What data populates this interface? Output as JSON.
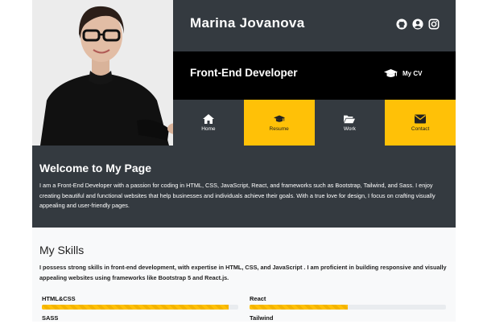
{
  "header": {
    "name": "Marina Jovanova",
    "job_title": "Front-End Developer",
    "cv_label": "My CV",
    "social_icons": [
      "github-icon",
      "user-circle-icon",
      "instagram-icon"
    ]
  },
  "nav": [
    {
      "label": "Home",
      "icon": "home-icon",
      "style": "dark"
    },
    {
      "label": "Resume",
      "icon": "graduation-cap-icon",
      "style": "yellow"
    },
    {
      "label": "Work",
      "icon": "folder-open-icon",
      "style": "dark"
    },
    {
      "label": "Contact",
      "icon": "envelope-icon",
      "style": "yellow"
    }
  ],
  "welcome": {
    "title": "Welcome to My Page",
    "text": "I am a Front-End Developer with a passion for coding in HTML, CSS, JavaScript, React, and frameworks such as Bootstrap, Tailwind, and Sass. I enjoy creating beautiful and functional websites that help businesses and individuals achieve their goals. With a true love for design, I focus on crafting visually appealing and user-friendly pages."
  },
  "skills": {
    "title": "My Skills",
    "text": "I possess strong skills in front-end development, with expertise in HTML, CSS, and JavaScript . I am proficient in building responsive and visually appealing websites using frameworks like Bootstrap 5 and React.js.",
    "items": [
      {
        "label": "HTML&CSS",
        "level": 0.95
      },
      {
        "label": "React",
        "level": 0.5
      },
      {
        "label": "SASS",
        "level": null
      },
      {
        "label": "Tailwind",
        "level": null
      }
    ]
  },
  "colors": {
    "dark": "#343a40",
    "black": "#000000",
    "accent": "#ffc107",
    "light": "#f8f9fa"
  }
}
